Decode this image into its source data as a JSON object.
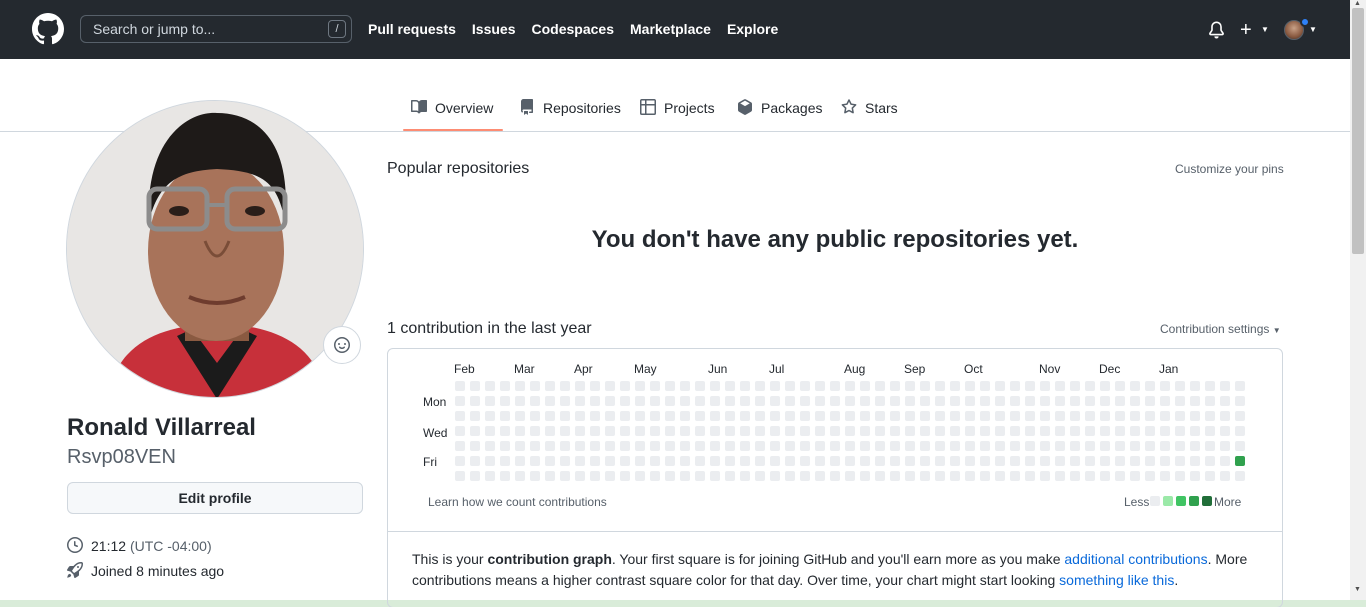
{
  "header": {
    "search_placeholder": "Search or jump to...",
    "search_shortcut": "/",
    "nav": [
      "Pull requests",
      "Issues",
      "Codespaces",
      "Marketplace",
      "Explore"
    ],
    "bg_color": "#24292f"
  },
  "tabs": [
    {
      "label": "Overview",
      "icon": "book-icon",
      "selected": true
    },
    {
      "label": "Repositories",
      "icon": "repo-icon",
      "selected": false
    },
    {
      "label": "Projects",
      "icon": "table-icon",
      "selected": false
    },
    {
      "label": "Packages",
      "icon": "package-icon",
      "selected": false
    },
    {
      "label": "Stars",
      "icon": "star-icon",
      "selected": false
    }
  ],
  "profile": {
    "name": "Ronald Villarreal",
    "login": "Rsvp08VEN",
    "edit_button": "Edit profile",
    "local_time": "21:12",
    "timezone": "(UTC -04:00)",
    "joined": "Joined 8 minutes ago"
  },
  "main": {
    "popular_title": "Popular repositories",
    "customize_pins": "Customize your pins",
    "empty_message": "You don't have any public repositories yet.",
    "contrib_title": "1 contribution in the last year",
    "contrib_settings": "Contribution settings",
    "learn_link": "Learn how we count contributions",
    "legend_less": "Less",
    "legend_more": "More",
    "info_1": "This is your ",
    "info_bold": "contribution graph",
    "info_2": ". Your first square is for joining GitHub and you'll earn more as you make ",
    "info_link_1": "additional contributions",
    "info_3": ". More contributions means a higher contrast square color for that day. Over time, your chart might start looking ",
    "info_link_2": "something like this",
    "info_4": "."
  },
  "calendar": {
    "months": [
      "Feb",
      "Mar",
      "Apr",
      "May",
      "Jun",
      "Jul",
      "Aug",
      "Sep",
      "Oct",
      "Nov",
      "Dec",
      "Jan"
    ],
    "days": [
      "Mon",
      "Wed",
      "Fri"
    ],
    "weeks": 53,
    "contributions": [
      {
        "week": 52,
        "weekday": 5,
        "count": 1
      }
    ],
    "empty_color": "#ebedf0",
    "level_colors": [
      "#ebedf0",
      "#9be9a8",
      "#40c463",
      "#30a14e",
      "#216e39"
    ]
  }
}
